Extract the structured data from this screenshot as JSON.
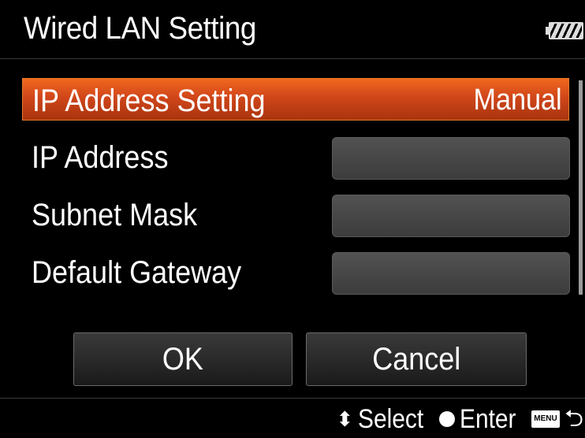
{
  "header": {
    "title": "Wired LAN Setting",
    "battery_icon": "battery-full-icon"
  },
  "rows": [
    {
      "label": "IP Address Setting",
      "value": "Manual"
    },
    {
      "label": "IP Address"
    },
    {
      "label": "Subnet Mask"
    },
    {
      "label": "Default Gateway"
    }
  ],
  "buttons": {
    "ok": "OK",
    "cancel": "Cancel"
  },
  "footer": {
    "select_icon": "up-down-arrows-icon",
    "select_label": "Select",
    "enter_icon": "center-button-dot-icon",
    "enter_label": "Enter",
    "menu_badge": "MENU",
    "back_icon": "return-arrow-icon"
  },
  "colors": {
    "accent": "#d1461a",
    "field": "#484848",
    "background": "#000000"
  }
}
